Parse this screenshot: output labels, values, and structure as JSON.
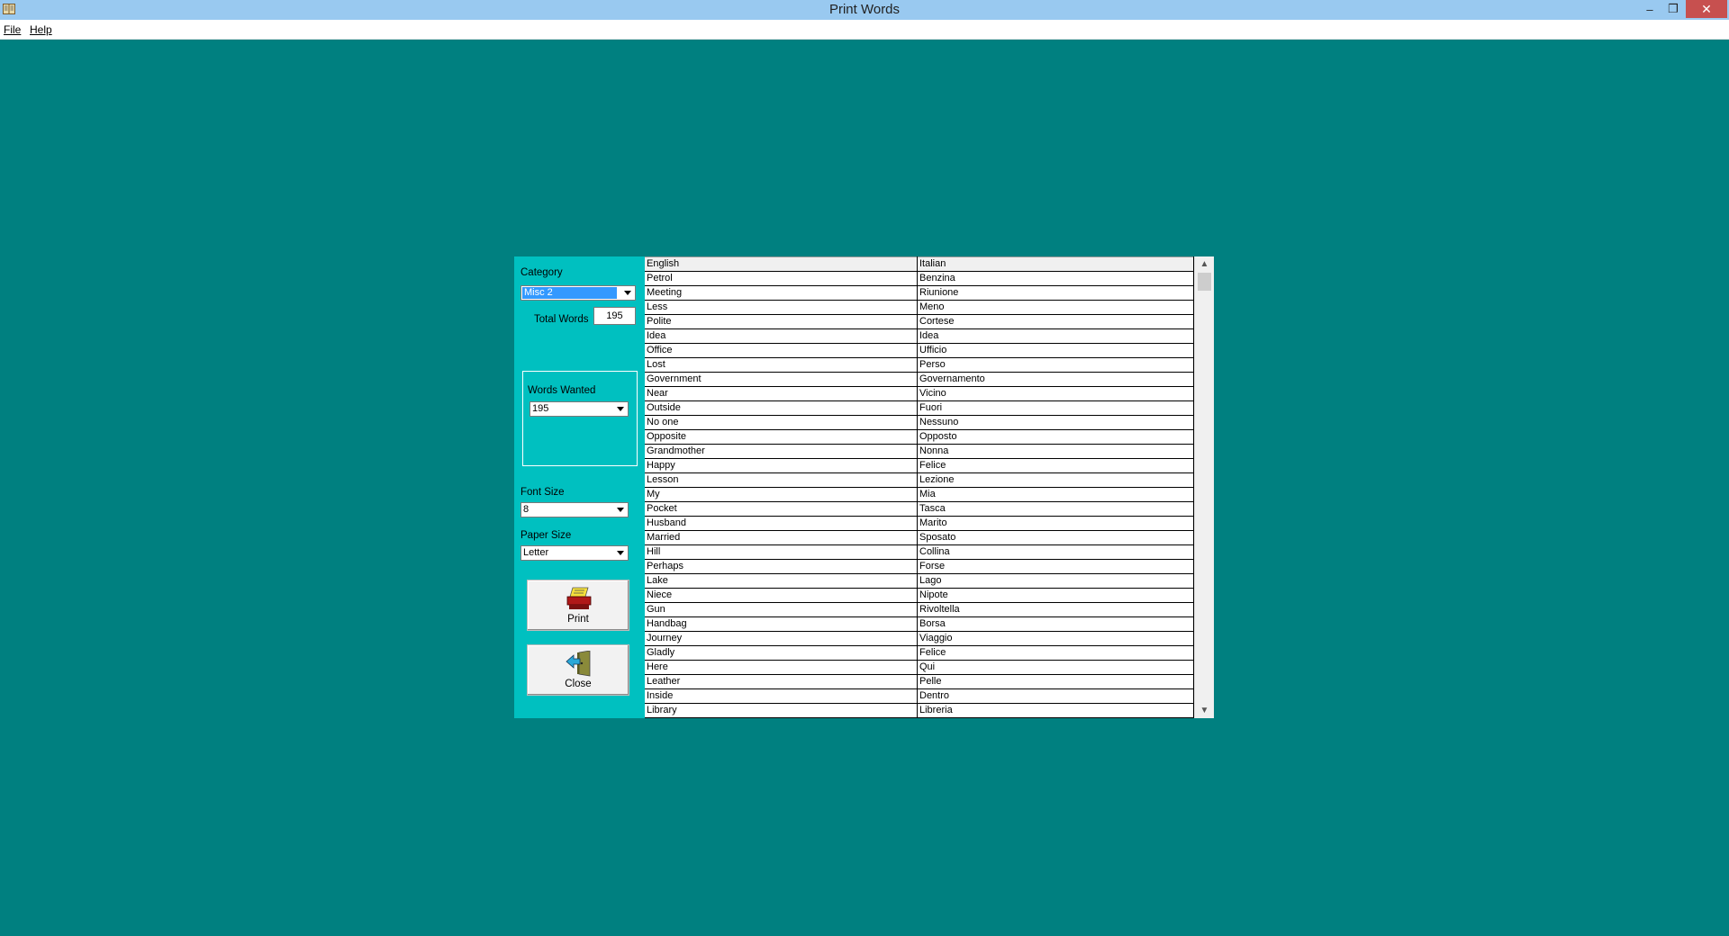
{
  "window": {
    "title": "Print Words",
    "minimize": "–",
    "restore": "❐",
    "close": "✕"
  },
  "menu": {
    "file_label": "File",
    "help_label": "Help"
  },
  "form": {
    "category_label": "Category",
    "category_value": "Misc 2",
    "total_words_label": "Total Words",
    "total_words_value": "195",
    "words_wanted_label": "Words Wanted",
    "words_wanted_value": "195",
    "font_size_label": "Font Size",
    "font_size_value": "8",
    "paper_size_label": "Paper Size",
    "paper_size_value": "Letter",
    "print_label": "Print",
    "close_label": "Close"
  },
  "grid": {
    "headers": [
      "English",
      "Italian"
    ],
    "rows": [
      [
        "Petrol",
        "Benzina"
      ],
      [
        "Meeting",
        "Riunione"
      ],
      [
        "Less",
        "Meno"
      ],
      [
        "Polite",
        "Cortese"
      ],
      [
        "Idea",
        "Idea"
      ],
      [
        "Office",
        "Ufficio"
      ],
      [
        "Lost",
        "Perso"
      ],
      [
        "Government",
        "Governamento"
      ],
      [
        "Near",
        "Vicino"
      ],
      [
        "Outside",
        "Fuori"
      ],
      [
        "No one",
        "Nessuno"
      ],
      [
        "Opposite",
        "Opposto"
      ],
      [
        "Grandmother",
        "Nonna"
      ],
      [
        "Happy",
        "Felice"
      ],
      [
        "Lesson",
        "Lezione"
      ],
      [
        "My",
        "Mia"
      ],
      [
        "Pocket",
        "Tasca"
      ],
      [
        "Husband",
        "Marito"
      ],
      [
        "Married",
        "Sposato"
      ],
      [
        "Hill",
        "Collina"
      ],
      [
        "Perhaps",
        "Forse"
      ],
      [
        "Lake",
        "Lago"
      ],
      [
        "Niece",
        "Nipote"
      ],
      [
        "Gun",
        "Rivoltella"
      ],
      [
        "Handbag",
        "Borsa"
      ],
      [
        "Journey",
        "Viaggio"
      ],
      [
        "Gladly",
        "Felice"
      ],
      [
        "Here",
        "Qui"
      ],
      [
        "Leather",
        "Pelle"
      ],
      [
        "Inside",
        "Dentro"
      ],
      [
        "Library",
        "Libreria"
      ]
    ]
  },
  "colors": {
    "desktop": "#008080",
    "dialog": "#00c0c0",
    "titlebar": "#99c9f0",
    "close_button": "#c7504f",
    "selection": "#3399ff"
  }
}
